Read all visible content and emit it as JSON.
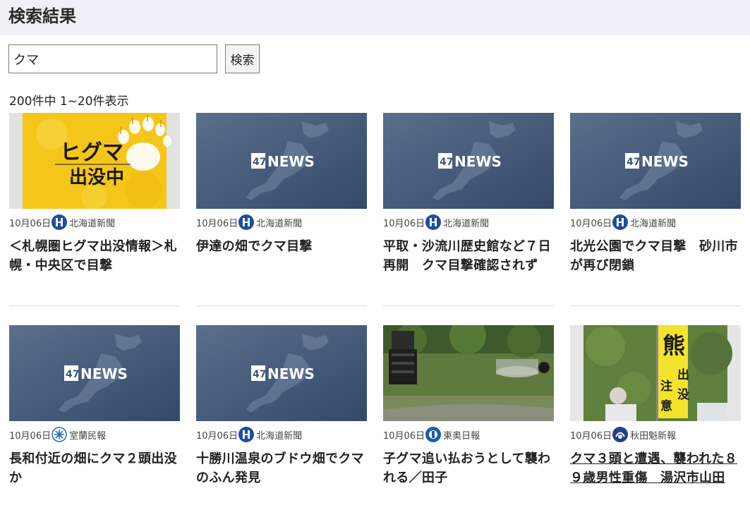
{
  "header": {
    "title": "検索結果"
  },
  "search": {
    "query": "クマ",
    "button_label": "検索"
  },
  "results": {
    "summary": "200件中 1~20件表示",
    "items": [
      {
        "date": "10月06日",
        "source": "北海道新聞",
        "title": "＜札幌圏ヒグマ出没情報＞札幌・中央区で目撃",
        "thumb": "higuma"
      },
      {
        "date": "10月06日",
        "source": "北海道新聞",
        "title": "伊達の畑でクマ目撃",
        "thumb": "47news"
      },
      {
        "date": "10月06日",
        "source": "北海道新聞",
        "title": "平取・沙流川歴史館など７日再開　クマ目撃確認されず",
        "thumb": "47news"
      },
      {
        "date": "10月06日",
        "source": "北海道新聞",
        "title": "北光公園でクマ目撃　砂川市が再び閉鎖",
        "thumb": "47news"
      },
      {
        "date": "10月06日",
        "source": "室蘭民報",
        "title": "長和付近の畑にクマ２頭出没か",
        "thumb": "47news"
      },
      {
        "date": "10月06日",
        "source": "北海道新聞",
        "title": "十勝川温泉のブドウ畑でクマのふん発見",
        "thumb": "47news"
      },
      {
        "date": "10月06日",
        "source": "東奥日報",
        "title": "子グマ追い払おうとして襲われる／田子",
        "thumb": "photo-field"
      },
      {
        "date": "10月06日",
        "source": "秋田魁新報",
        "title": "クマ３頭と遭遇、襲われた８９歳男性重傷　湯沢市山田",
        "thumb": "photo-banner"
      }
    ]
  },
  "thumb_text": {
    "news_logo_num": "47",
    "news_logo_word": "NEWS",
    "higuma_line1": "ヒグマ",
    "higuma_line2": "出没中",
    "banner_big": "熊",
    "banner_small1": "出",
    "banner_small2": "没",
    "banner_small3": "注",
    "banner_small4": "意"
  },
  "colors": {
    "header_bg": "#eef1f7",
    "news_bg": "#3f5878",
    "higuma_bg": "#f5c61a",
    "hokkaido_logo": "#1b4f9c",
    "muroran_logo": "#2b6cb0",
    "toou_logo": "#1a5ea8",
    "akita_logo": "#1f3f8a"
  }
}
